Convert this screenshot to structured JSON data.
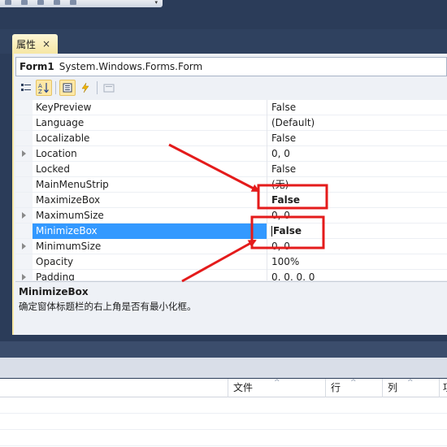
{
  "panel": {
    "tab_label": "属性",
    "tab_close": "×",
    "object_name": "Form1",
    "object_type": "System.Windows.Forms.Form"
  },
  "toolbar_icons": [
    "categorized-icon",
    "alphabetical-icon",
    "properties-icon",
    "events-icon",
    "property-pages-icon"
  ],
  "properties": [
    {
      "name": "KeyPreview",
      "value": "False",
      "expandable": false,
      "bold": false
    },
    {
      "name": "Language",
      "value": "(Default)",
      "expandable": false,
      "bold": false
    },
    {
      "name": "Localizable",
      "value": "False",
      "expandable": false,
      "bold": false
    },
    {
      "name": "Location",
      "value": "0, 0",
      "expandable": true,
      "bold": false
    },
    {
      "name": "Locked",
      "value": "False",
      "expandable": false,
      "bold": false
    },
    {
      "name": "MainMenuStrip",
      "value": "(无)",
      "expandable": false,
      "bold": false
    },
    {
      "name": "MaximizeBox",
      "value": "False",
      "expandable": false,
      "bold": true
    },
    {
      "name": "MaximumSize",
      "value": "0, 0",
      "expandable": true,
      "bold": false
    },
    {
      "name": "MinimizeBox",
      "value": "False",
      "expandable": false,
      "bold": true,
      "selected": true
    },
    {
      "name": "MinimumSize",
      "value": "0, 0",
      "expandable": true,
      "bold": false
    },
    {
      "name": "Opacity",
      "value": "100%",
      "expandable": false,
      "bold": false
    },
    {
      "name": "Padding",
      "value": "0, 0, 0, 0",
      "expandable": true,
      "bold": false
    }
  ],
  "description": {
    "title": "MinimizeBox",
    "text": "确定窗体标题栏的右上角是否有最小化框。"
  },
  "list_columns": [
    "文件",
    "行",
    "列",
    "项"
  ],
  "colors": {
    "selection": "#3399ff",
    "tab_active": "#f6e7a4",
    "annotation": "#e41b1b"
  }
}
